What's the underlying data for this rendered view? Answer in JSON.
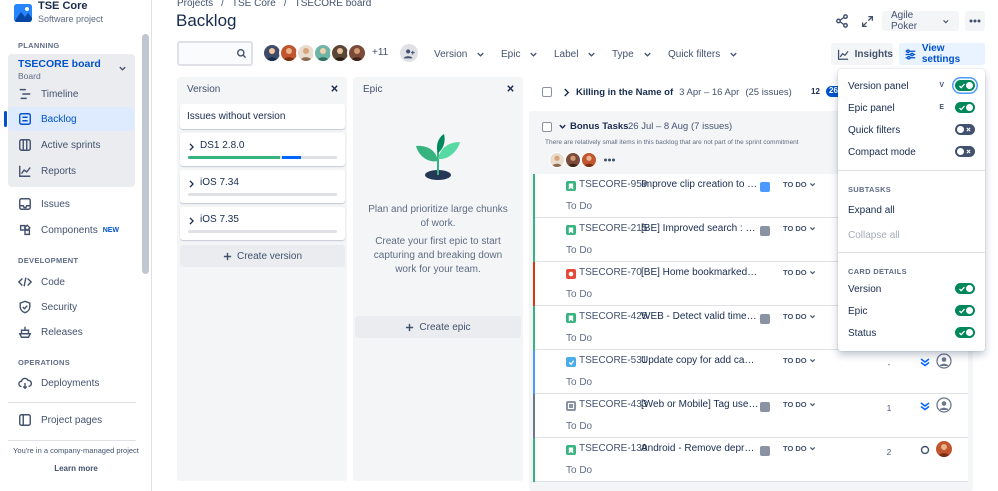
{
  "project": {
    "name": "TSE Core",
    "type": "Software project"
  },
  "sidebar": {
    "planning_heading": "PLANNING",
    "board": {
      "title": "TSECORE board",
      "subtitle": "Board"
    },
    "planning_items": [
      {
        "label": "Timeline",
        "icon": "timeline-icon"
      },
      {
        "label": "Backlog",
        "icon": "backlog-icon",
        "active": true
      },
      {
        "label": "Active sprints",
        "icon": "active-sprints-icon"
      },
      {
        "label": "Reports",
        "icon": "reports-icon"
      }
    ],
    "issues_label": "Issues",
    "components_label": "Components",
    "components_badge": "NEW",
    "development_heading": "DEVELOPMENT",
    "development_items": [
      {
        "label": "Code",
        "icon": "code-icon"
      },
      {
        "label": "Security",
        "icon": "shield-icon"
      },
      {
        "label": "Releases",
        "icon": "ship-icon"
      }
    ],
    "operations_heading": "OPERATIONS",
    "operations_items": [
      {
        "label": "Deployments",
        "icon": "cloud-icon"
      }
    ],
    "project_pages": "Project pages",
    "company_note": "You're in a company-managed project",
    "learn_more": "Learn more"
  },
  "breadcrumb": [
    "Projects",
    "TSE Core",
    "TSECORE board"
  ],
  "page_title": "Backlog",
  "header": {
    "agile_poker": "Agile Poker"
  },
  "toolbar": {
    "search_placeholder": "",
    "avatar_overflow": "+11",
    "filters": [
      "Version",
      "Epic",
      "Label",
      "Type",
      "Quick filters"
    ],
    "insights": "Insights",
    "view_settings": "View settings"
  },
  "version_panel": {
    "title": "Version",
    "no_version": "Issues without version",
    "versions": [
      {
        "name": "DS1 2.8.0",
        "done": 0.62,
        "in_progress": 0.13
      },
      {
        "name": "iOS 7.34",
        "done": 0,
        "in_progress": 0
      },
      {
        "name": "iOS 7.35",
        "done": 0,
        "in_progress": 0
      }
    ],
    "create": "Create version"
  },
  "epic_panel": {
    "title": "Epic",
    "text1": "Plan and prioritize large chunks of work.",
    "text2": "Create your first epic to start capturing and breaking down work for your team.",
    "create": "Create epic"
  },
  "sprint": {
    "name": "Killing in the Name of",
    "dates": "3 Apr – 16 Apr",
    "count": "(25 issues)",
    "points_a": "12",
    "points_b": "26"
  },
  "backlog": {
    "name": "Bonus Tasks",
    "dates": "26 Jul – 8 Aug",
    "count": "(7 issues)",
    "note": "There are relatively small items in this backlog that are not part of the sprint commitment",
    "issues": [
      {
        "key": "TSECORE-959",
        "summary": "Improve clip creation to fa...",
        "type": "story",
        "status": "TO DO",
        "status_text": "To Do",
        "edge": "#36b37e",
        "epic": "#4c9aff",
        "estimate": "",
        "priority": "",
        "assignee": ""
      },
      {
        "key": "TSECORE-215",
        "summary": "[BE] Improved search : mu...",
        "type": "story",
        "status": "TO DO",
        "status_text": "To Do",
        "edge": "#36b37e",
        "epic": "#8993a4",
        "estimate": "",
        "priority": "",
        "assignee": ""
      },
      {
        "key": "TSECORE-70",
        "summary": "[BE] Home bookmarked se...",
        "type": "bug",
        "status": "TO DO",
        "status_text": "To Do",
        "edge": "#de350b",
        "epic": "",
        "estimate": "",
        "priority": "",
        "assignee": ""
      },
      {
        "key": "TSECORE-425",
        "summary": "WEB - Detect valid timest...",
        "type": "story",
        "status": "TO DO",
        "status_text": "To Do",
        "edge": "#36b37e",
        "epic": "#8993a4",
        "estimate": "",
        "priority": "",
        "assignee": ""
      },
      {
        "key": "TSECORE-531",
        "summary": "Update copy for add case ...",
        "type": "task",
        "status": "TO DO",
        "status_text": "To Do",
        "edge": "#4c9aff",
        "epic": "",
        "estimate": "-",
        "priority": "lowest",
        "assignee": "empty"
      },
      {
        "key": "TSECORE-433",
        "summary": "[Web or Mobile] Tag user i...",
        "type": "subtask",
        "status": "TO DO",
        "status_text": "To Do",
        "edge": "#6b778c",
        "epic": "#8993a4",
        "estimate": "1",
        "priority": "lowest",
        "assignee": "empty"
      },
      {
        "key": "TSECORE-139",
        "summary": "Android - Remove deprec...",
        "type": "story",
        "status": "TO DO",
        "status_text": "To Do",
        "edge": "#36b37e",
        "epic": "#8993a4",
        "estimate": "2",
        "priority": "minor",
        "assignee": "photo"
      }
    ]
  },
  "view_settings": {
    "panels": [
      {
        "label": "Version panel",
        "shortcut": "V",
        "on": true,
        "focus": true
      },
      {
        "label": "Epic panel",
        "shortcut": "E",
        "on": true,
        "focus": false
      },
      {
        "label": "Quick filters",
        "shortcut": "",
        "on": false,
        "focus": false
      },
      {
        "label": "Compact mode",
        "shortcut": "",
        "on": false,
        "focus": false
      }
    ],
    "subtasks_heading": "SUBTASKS",
    "expand_all": "Expand all",
    "collapse_all": "Collapse all",
    "card_details_heading": "CARD DETAILS",
    "card_details": [
      {
        "label": "Version",
        "on": true
      },
      {
        "label": "Epic",
        "on": true
      },
      {
        "label": "Status",
        "on": true
      }
    ]
  },
  "colors": {
    "accent": "#0052cc",
    "story": "#36b37e",
    "bug": "#e5493a",
    "task": "#4bade8",
    "subtask": "#8993a4"
  }
}
